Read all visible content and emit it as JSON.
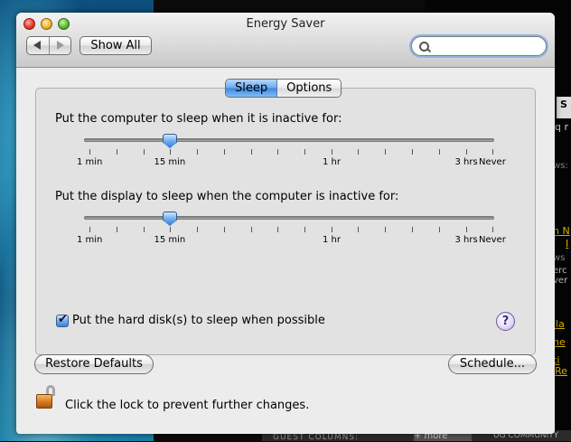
{
  "background": {
    "snippets": {
      "s": "S",
      "q": "q r",
      "ws1": "ws:",
      "yn": "n N",
      "yl": "I",
      "ws2": "ws",
      "erc": "erc",
      "ver": "ver",
      "ila": "ila",
      "ne": "ne",
      "ti": "ti",
      "re": "Re"
    },
    "bottom_bar": {
      "guest": "GUEST COLUMNS:",
      "more": "+ more",
      "ug": "UG COMMUNITY"
    }
  },
  "window": {
    "title": "Energy Saver",
    "toolbar": {
      "show_all": "Show All",
      "search": {
        "value": "",
        "placeholder": ""
      }
    },
    "tabs": [
      {
        "label": "Sleep",
        "active": true
      },
      {
        "label": "Options",
        "active": false
      }
    ],
    "computer_sleep": {
      "label": "Put the computer to sleep when it is inactive for:",
      "tick_labels": [
        "1 min",
        "15 min",
        "1 hr",
        "3 hrs",
        "Never"
      ],
      "selected": "15 min"
    },
    "display_sleep": {
      "label": "Put the display to sleep when the computer is inactive for:",
      "tick_labels": [
        "1 min",
        "15 min",
        "1 hr",
        "3 hrs",
        "Never"
      ],
      "selected": "15 min"
    },
    "hard_disk": {
      "label": "Put the hard disk(s) to sleep when possible",
      "checked": true
    },
    "help": "?",
    "restore_defaults": "Restore Defaults",
    "schedule": "Schedule...",
    "lock_text": "Click the lock to prevent further changes."
  },
  "colors": {
    "accent": "#3a82d8",
    "window_bg": "#ececec"
  }
}
